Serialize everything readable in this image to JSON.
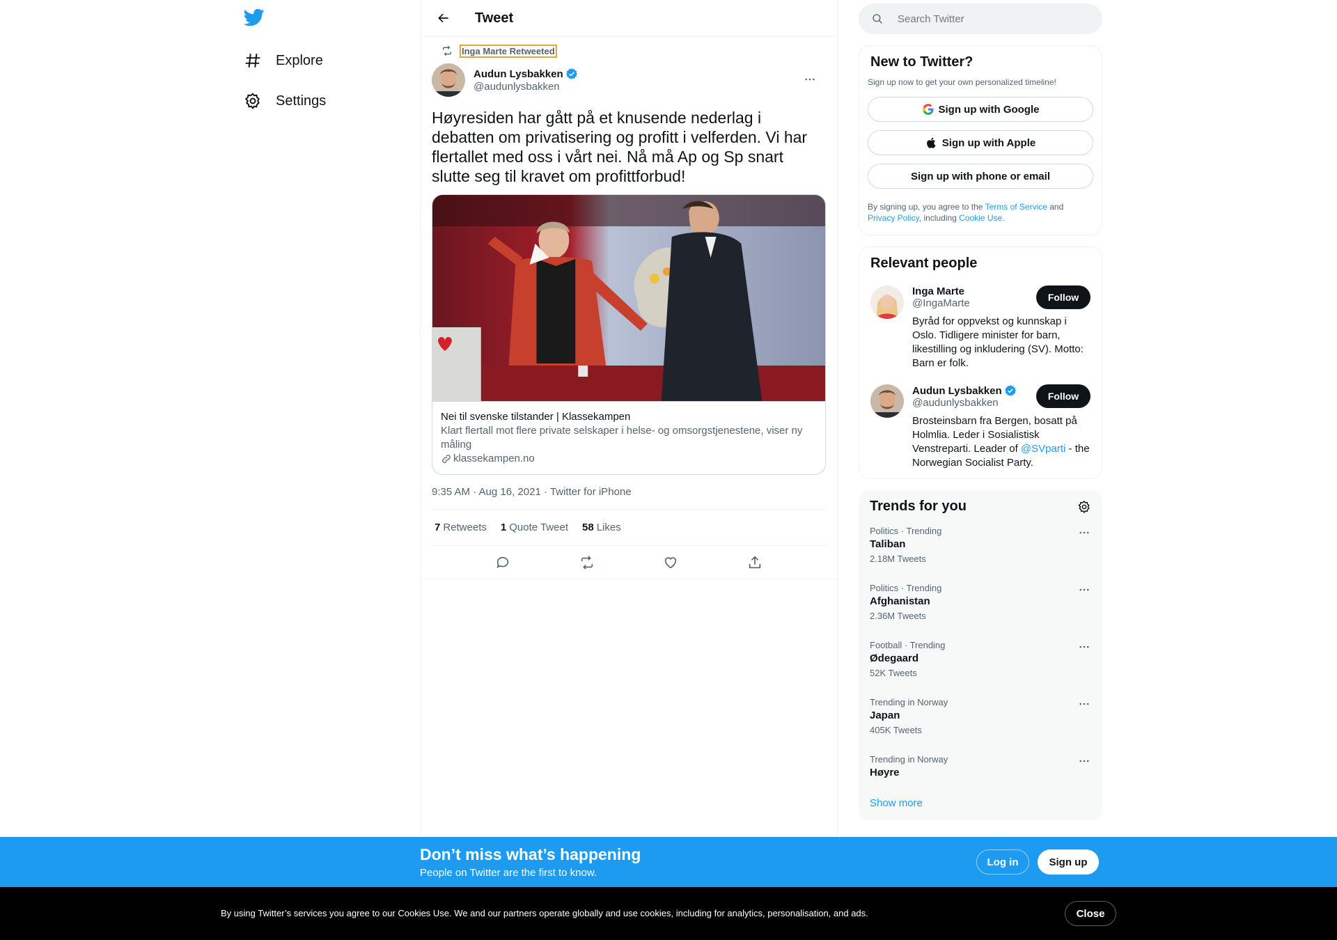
{
  "nav": {
    "logo": "twitter-bird-icon",
    "items": [
      {
        "label": "Explore",
        "icon": "hashtag-icon"
      },
      {
        "label": "Settings",
        "icon": "gear-icon"
      }
    ]
  },
  "header": {
    "title": "Tweet"
  },
  "tweet": {
    "retweeted_by": "Inga Marte Retweeted",
    "author_name": "Audun Lysbakken",
    "author_handle": "@audunlysbakken",
    "text": "Høyresiden har gått på et knusende nederlag i debatten om privatisering og profitt i velferden. Vi har flertallet med oss i vårt nei. Nå må Ap og Sp snart slutte seg til kravet om profittforbud!",
    "card": {
      "title": "Nei til svenske tilstander | Klassekampen",
      "description": "Klart flertall mot flere private selskaper i helse- og omsorgstjenestene, viser ny måling",
      "domain": "klassekampen.no"
    },
    "timestamp": "9:35 AM · Aug 16, 2021 · Twitter for iPhone",
    "stats": {
      "retweets_count": "7",
      "retweets_label": "Retweets",
      "quotes_count": "1",
      "quotes_label": "Quote Tweet",
      "likes_count": "58",
      "likes_label": "Likes"
    }
  },
  "search": {
    "placeholder": "Search Twitter"
  },
  "new_to_twitter": {
    "title": "New to Twitter?",
    "subtitle": "Sign up now to get your own personalized timeline!",
    "google": "Sign up with Google",
    "apple": "Sign up with Apple",
    "phone": "Sign up with phone or email",
    "legal_1": "By signing up, you agree to the ",
    "terms": "Terms of Service",
    "legal_2": " and ",
    "privacy": "Privacy Policy",
    "legal_3": ", including ",
    "cookie": "Cookie Use."
  },
  "relevant_people": {
    "title": "Relevant people",
    "people": [
      {
        "name": "Inga Marte",
        "handle": "@IngaMarte",
        "bio": "Byråd for oppvekst og kunnskap i Oslo. Tidligere minister for barn, likestilling og inkludering (SV). Motto: Barn er folk.",
        "follow": "Follow"
      },
      {
        "name": "Audun Lysbakken",
        "handle": "@audunlysbakken",
        "bio_1": "Brosteinsbarn fra Bergen, bosatt på Holmlia. Leder i Sosialistisk Venstreparti. Leader of ",
        "bio_link": "@SVparti",
        "bio_2": " - the Norwegian Socialist Party.",
        "follow": "Follow"
      }
    ]
  },
  "trends": {
    "title": "Trends for you",
    "items": [
      {
        "context": "Politics · Trending",
        "name": "Taliban",
        "count": "2.18M Tweets"
      },
      {
        "context": "Politics · Trending",
        "name": "Afghanistan",
        "count": "2.36M Tweets"
      },
      {
        "context": "Football · Trending",
        "name": "Ødegaard",
        "count": "52K Tweets"
      },
      {
        "context": "Trending in Norway",
        "name": "Japan",
        "count": "405K Tweets"
      },
      {
        "context": "Trending in Norway",
        "name": "Høyre",
        "count": ""
      }
    ],
    "show_more": "Show more"
  },
  "bottom_bar": {
    "title": "Don’t miss what’s happening",
    "subtitle": "People on Twitter are the first to know.",
    "login": "Log in",
    "signup": "Sign up"
  },
  "cookie_bar": {
    "text": "By using Twitter’s services you agree to our Cookies Use. We and our partners operate globally and use cookies, including for analytics, personalisation, and ads.",
    "close": "Close"
  },
  "colors": {
    "accent": "#1d9bf0",
    "text": "#0f1419",
    "secondary": "#536471"
  }
}
